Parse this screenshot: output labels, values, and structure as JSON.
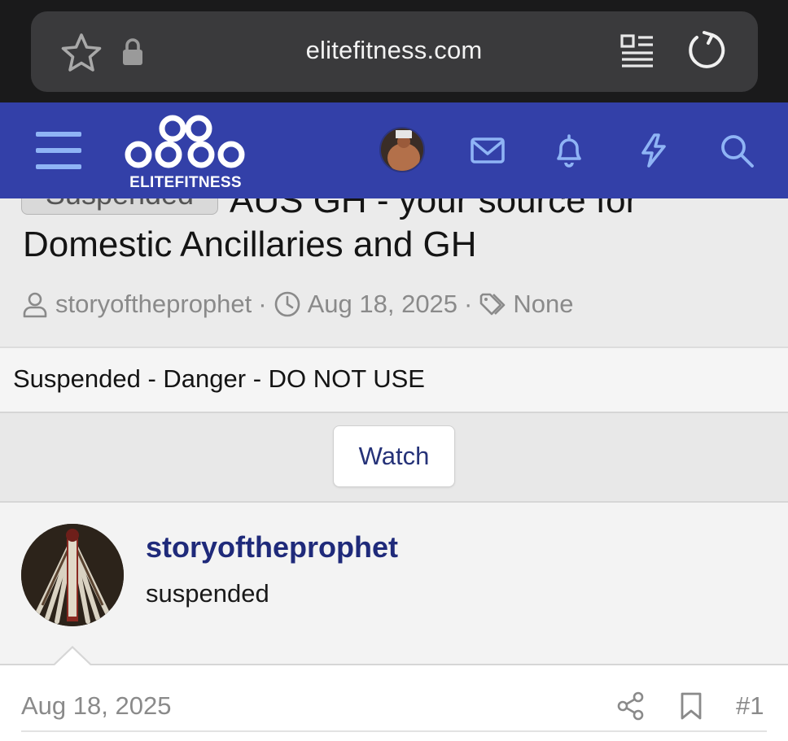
{
  "browser": {
    "url": "elitefitness.com",
    "icons": [
      "star-icon",
      "lock-icon",
      "reader-mode-icon",
      "reload-icon"
    ]
  },
  "header": {
    "logo_text": "ELITEFITNESS",
    "icons": [
      "hamburger-menu-icon",
      "user-avatar",
      "inbox-icon",
      "alerts-bell-icon",
      "whats-new-bolt-icon",
      "search-icon"
    ],
    "brand_color": "#3340a8",
    "icon_color": "#8fb4f5"
  },
  "thread": {
    "prefix": "Suspended",
    "title_line1": "AUS GH - your source for",
    "title_line2": "Domestic Ancillaries and GH",
    "author": "storyoftheprophet",
    "date": "Aug 18, 2025",
    "tags": "None"
  },
  "notice": {
    "text": "Suspended - Danger - DO NOT USE"
  },
  "watch": {
    "label": "Watch"
  },
  "post": {
    "username": "storyoftheprophet",
    "user_title": "suspended",
    "date": "Aug 18, 2025",
    "number": "#1",
    "username_color": "#1f2a7a"
  }
}
